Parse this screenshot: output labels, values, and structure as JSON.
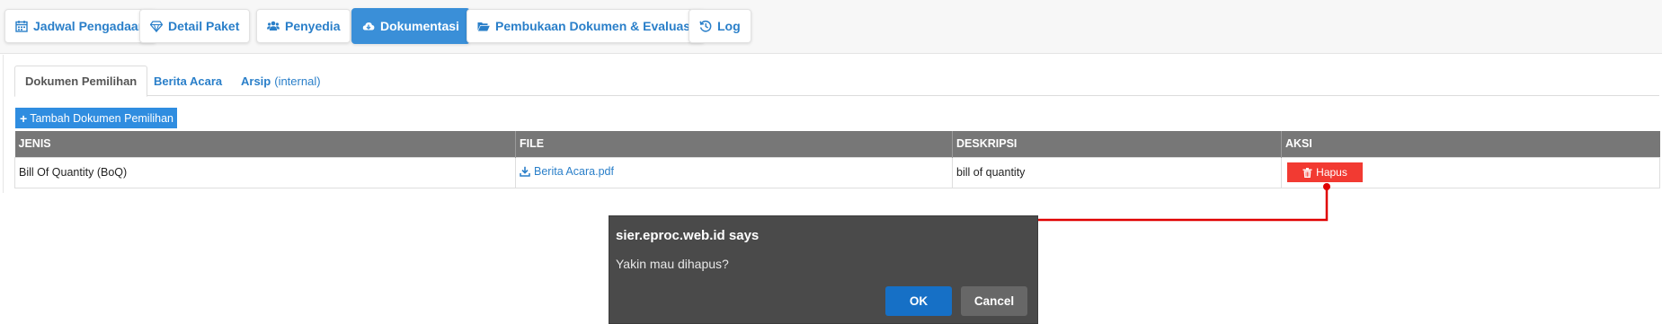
{
  "nav": {
    "items": [
      {
        "label": "Jadwal Pengadaan",
        "icon": "calendar-icon",
        "active": false
      },
      {
        "label": "Detail Paket",
        "icon": "diamond-icon",
        "active": false
      },
      {
        "label": "Penyedia",
        "icon": "users-icon",
        "active": false
      },
      {
        "label": "Dokumentasi",
        "icon": "cloud-download-icon",
        "active": true
      },
      {
        "label": "Pembukaan Dokumen & Evaluasi",
        "icon": "folder-open-icon",
        "active": false
      },
      {
        "label": "Log",
        "icon": "history-icon",
        "active": false
      }
    ]
  },
  "tabs": {
    "items": [
      {
        "label": "Dokumen Pemilihan",
        "sub": "",
        "active": true
      },
      {
        "label": "Berita Acara",
        "sub": "",
        "active": false
      },
      {
        "label": "Arsip",
        "sub": "(internal)",
        "active": false
      }
    ]
  },
  "add_button": {
    "label": "Tambah Dokumen Pemilihan",
    "icon": "plus-icon"
  },
  "table": {
    "headers": [
      "JENIS",
      "FILE",
      "DESKRIPSI",
      "AKSI"
    ],
    "rows": [
      {
        "jenis": "Bill Of Quantity (BoQ)",
        "file": "Berita Acara.pdf",
        "deskripsi": "bill of quantity",
        "action": "Hapus"
      }
    ]
  },
  "dialog": {
    "title": "sier.eproc.web.id says",
    "message": "Yakin mau dihapus?",
    "ok_label": "OK",
    "cancel_label": "Cancel"
  },
  "colors": {
    "accent": "#3a8fd8",
    "link": "#2a7fc9",
    "danger": "#f23a32",
    "header_bg": "#777777",
    "dialog_bg": "#4a4a4a",
    "ok_bg": "#1670c6",
    "annotation": "#e00000"
  }
}
